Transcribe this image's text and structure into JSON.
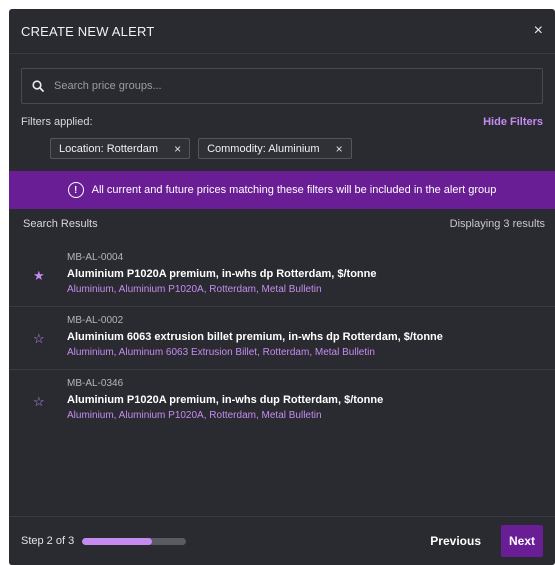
{
  "header": {
    "title": "CREATE NEW ALERT",
    "close_icon": "×"
  },
  "search": {
    "placeholder": "Search price groups...",
    "value": ""
  },
  "filters": {
    "label": "Filters applied:",
    "hide_label": "Hide Filters",
    "chips": [
      {
        "label": "Location: Rotterdam",
        "remove": "×"
      },
      {
        "label": "Commodity: Aluminium",
        "remove": "×"
      }
    ]
  },
  "banner": {
    "icon": "!",
    "text": "All current and future prices matching these filters will be included in the alert group"
  },
  "results": {
    "heading": "Search Results",
    "count": "Displaying 3 results",
    "items": [
      {
        "code": "MB-AL-0004",
        "name": "Aluminium P1020A premium, in-whs dp Rotterdam, $/tonne",
        "tags": "Aluminium, Aluminium P1020A, Rotterdam, Metal Bulletin",
        "star": "★"
      },
      {
        "code": "MB-AL-0002",
        "name": "Aluminium 6063 extrusion billet premium, in-whs dp Rotterdam, $/tonne",
        "tags": "Aluminium, Aluminum 6063 Extrusion Billet, Rotterdam, Metal Bulletin",
        "star": "☆"
      },
      {
        "code": "MB-AL-0346",
        "name": "Aluminium P1020A premium, in-whs dup Rotterdam, $/tonne",
        "tags": "Aluminium, Aluminium P1020A, Rotterdam, Metal Bulletin",
        "star": "☆"
      }
    ]
  },
  "footer": {
    "step_label": "Step 2 of 3",
    "progress_percent": 67,
    "previous_label": "Previous",
    "next_label": "Next"
  },
  "colors": {
    "accent": "#c58bf1",
    "banner": "#6a1e95",
    "background": "#2a2b30"
  }
}
